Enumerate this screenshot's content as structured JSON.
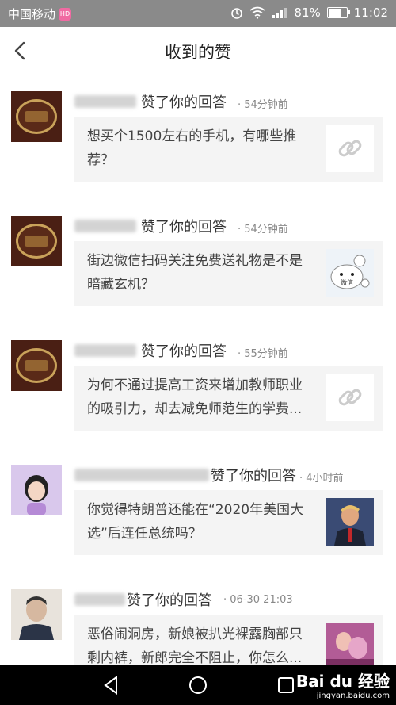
{
  "status_bar": {
    "carrier": "中国移动",
    "carrier_badge": "HD",
    "battery_text": "81%",
    "battery_level": 0.81,
    "time": "11:02"
  },
  "header": {
    "title": "收到的赞"
  },
  "items": [
    {
      "action": "赞了你的回答",
      "time": "· 54分钟前",
      "text": "想买个1500左右的手机，有哪些推荐？",
      "thumb": "link-icon"
    },
    {
      "action": "赞了你的回答",
      "time": "· 54分钟前",
      "text": "街边微信扫码关注免费送礼物是不是暗藏玄机？",
      "thumb": "wechat-image"
    },
    {
      "action": "赞了你的回答",
      "time": "· 55分钟前",
      "text": "为何不通过提高工资来增加教师职业的吸引力，却去减免师范生的学费...",
      "thumb": "link-icon"
    },
    {
      "action": "赞了你的回答",
      "time": "· 4小时前",
      "text": "你觉得特朗普还能在“2020年美国大选”后连任总统吗？",
      "thumb": "trump-image"
    },
    {
      "action": "赞了你的回答",
      "time": "· 06-30 21:03",
      "text": "恶俗闹洞房，新娘被扒光裸露胸部只剩内裤，新郎完全不阻止，你怎么...",
      "thumb": "bride-image"
    }
  ],
  "thumb_wechat_label": "微信",
  "watermark": {
    "brand": "Bai du 经验",
    "url": "jingyan.baidu.com"
  }
}
